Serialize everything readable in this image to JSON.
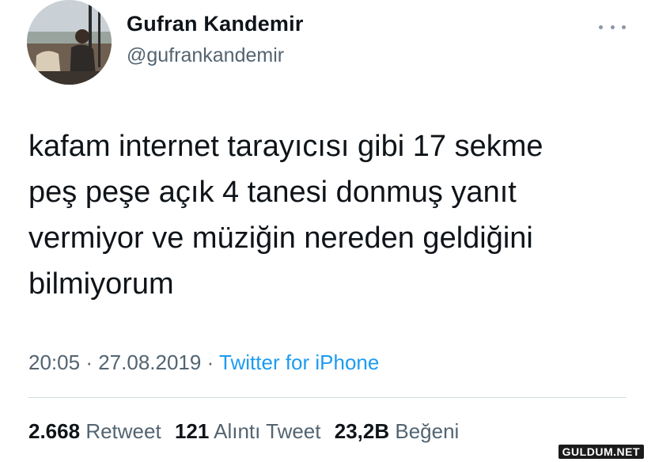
{
  "author": {
    "display_name": "Gufran Kandemir",
    "handle": "@gufrankandemir"
  },
  "tweet": {
    "text": "kafam internet tarayıcısı gibi 17 sekme\npeş peşe açık 4 tanesi donmuş yanıt\nvermiyor ve müziğin nereden geldiğini\nbilmiyorum",
    "time": "20:05",
    "date": "27.08.2019",
    "separator": "·",
    "source": "Twitter for iPhone"
  },
  "stats": {
    "retweets_count": "2.668",
    "retweets_label": "Retweet",
    "quotes_count": "121",
    "quotes_label": "Alıntı Tweet",
    "likes_count": "23,2B",
    "likes_label": "Beğeni"
  },
  "watermark": "GULDUM.NET",
  "icons": {
    "more": "more-horizontal-icon"
  },
  "colors": {
    "text_primary": "#0f1419",
    "text_secondary": "#536471",
    "link": "#1d9bf0",
    "divider": "#cfd9de"
  }
}
